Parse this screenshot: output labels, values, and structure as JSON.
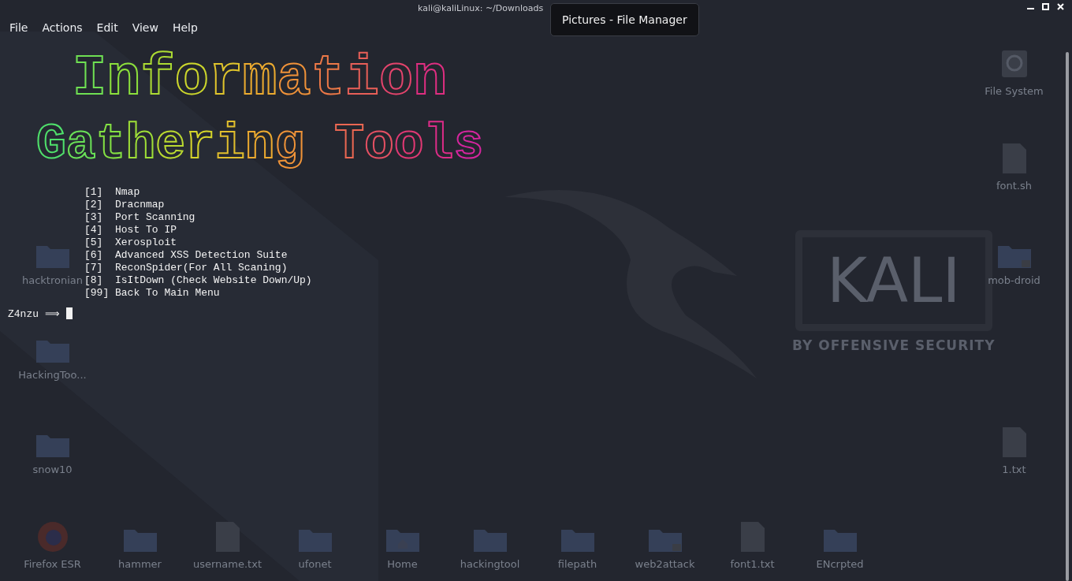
{
  "window": {
    "title": "kali@kaliLinux: ~/Downloads",
    "menu": [
      "File",
      "Actions",
      "Edit",
      "View",
      "Help"
    ]
  },
  "tooltip": "Pictures - File Manager",
  "wallpaper": {
    "logo": "KALI",
    "tagline": "BY OFFENSIVE SECURITY"
  },
  "desktop": {
    "left_column": [
      {
        "label": "hacktronian",
        "kind": "folder"
      },
      {
        "label": "HackingToo...",
        "kind": "folder"
      },
      {
        "label": "snow10",
        "kind": "folder"
      }
    ],
    "right_column": [
      {
        "label": "File System",
        "kind": "drive"
      },
      {
        "label": "font.sh",
        "kind": "script"
      },
      {
        "label": "mob-droid",
        "kind": "locked-folder"
      },
      {
        "label": "1.txt",
        "kind": "file"
      }
    ],
    "bottom_row": [
      {
        "label": "Firefox ESR",
        "kind": "browser"
      },
      {
        "label": "hammer",
        "kind": "folder"
      },
      {
        "label": "username.txt",
        "kind": "file"
      },
      {
        "label": "ufonet",
        "kind": "folder"
      },
      {
        "label": "Home",
        "kind": "home-folder"
      },
      {
        "label": "hackingtool",
        "kind": "folder"
      },
      {
        "label": "filepath",
        "kind": "folder"
      },
      {
        "label": "web2attack",
        "kind": "locked-folder"
      },
      {
        "label": "font1.txt",
        "kind": "file"
      },
      {
        "label": "ENcrpted",
        "kind": "folder"
      }
    ]
  },
  "terminal": {
    "banner": [
      "Information",
      "Gathering Tools"
    ],
    "options": [
      {
        "key": "[1]",
        "label": "Nmap"
      },
      {
        "key": "[2]",
        "label": "Dracnmap"
      },
      {
        "key": "[3]",
        "label": "Port Scanning"
      },
      {
        "key": "[4]",
        "label": "Host To IP"
      },
      {
        "key": "[5]",
        "label": "Xerosploit"
      },
      {
        "key": "[6]",
        "label": "Advanced XSS Detection Suite"
      },
      {
        "key": "[7]",
        "label": "ReconSpider(For All Scaning)"
      },
      {
        "key": "[8]",
        "label": "IsItDown (Check Website Down/Up)"
      },
      {
        "key": "[99]",
        "label": "Back To Main Menu"
      }
    ],
    "prompt": "Z4nzu ⟹"
  }
}
